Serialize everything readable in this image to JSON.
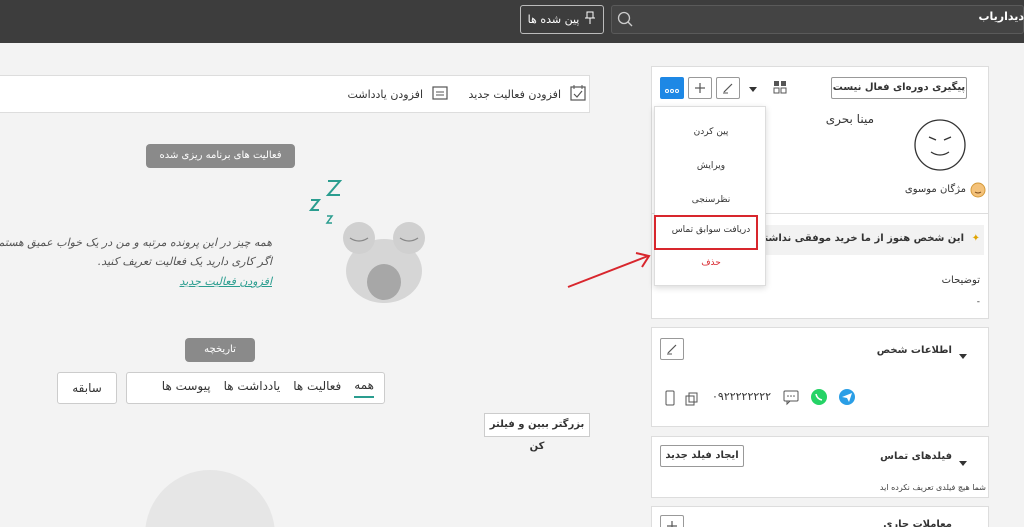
{
  "topbar": {
    "brand": "دیداریاب",
    "pinned_label": "پین شده ها",
    "search_icon": "search-icon"
  },
  "activity_toolbar": {
    "add_activity": "افزودن فعالیت جدید",
    "add_note": "افزودن یادداشت"
  },
  "planned": {
    "pill": "فعالیت های برنامه ریزی شده",
    "line1": "همه چیز در این پرونده مرتبه و من در یک خواب عمیق هستم!",
    "line2": "اگر کاری دارید یک فعالیت تعریف کنید.",
    "link": "افزودن فعالیت جدید"
  },
  "history": {
    "pill": "تاریخچه",
    "tabs": [
      "همه",
      "فعالیت ها",
      "یادداشت ها",
      "پیوست ها"
    ],
    "prev": "سابقه",
    "enlarge": "بزرگتر ببین و فیلتر کن"
  },
  "person_card": {
    "stage": "پیگیری دوره‌ای فعال نیست",
    "name": "مینا بحری",
    "owner": "مژگان موسوی",
    "alert": "این شخص هنوز از ما خرید موفقی نداشته است.",
    "desc_label": "توضیحات",
    "desc_value": "-"
  },
  "menu": {
    "items": [
      "پین کردن",
      "ویرایش",
      "نظرسنجی",
      "دریافت سوابق تماس",
      "حذف"
    ]
  },
  "person_info": {
    "title": "اطلاعات شخص",
    "phone": "۰۹۲۲۲۲۲۲۲۲"
  },
  "contact_fields": {
    "title": "فیلدهای تماس",
    "new_field": "ایجاد فیلد جدید",
    "empty": "شما هیچ فیلدی تعریف نکرده اید"
  },
  "deals": {
    "title": "معاملات جاری"
  },
  "colors": {
    "topbar": "#3d3d3d",
    "accent": "#2a9d8f",
    "menu_active": "#1e88e5",
    "danger": "#d8262d"
  }
}
